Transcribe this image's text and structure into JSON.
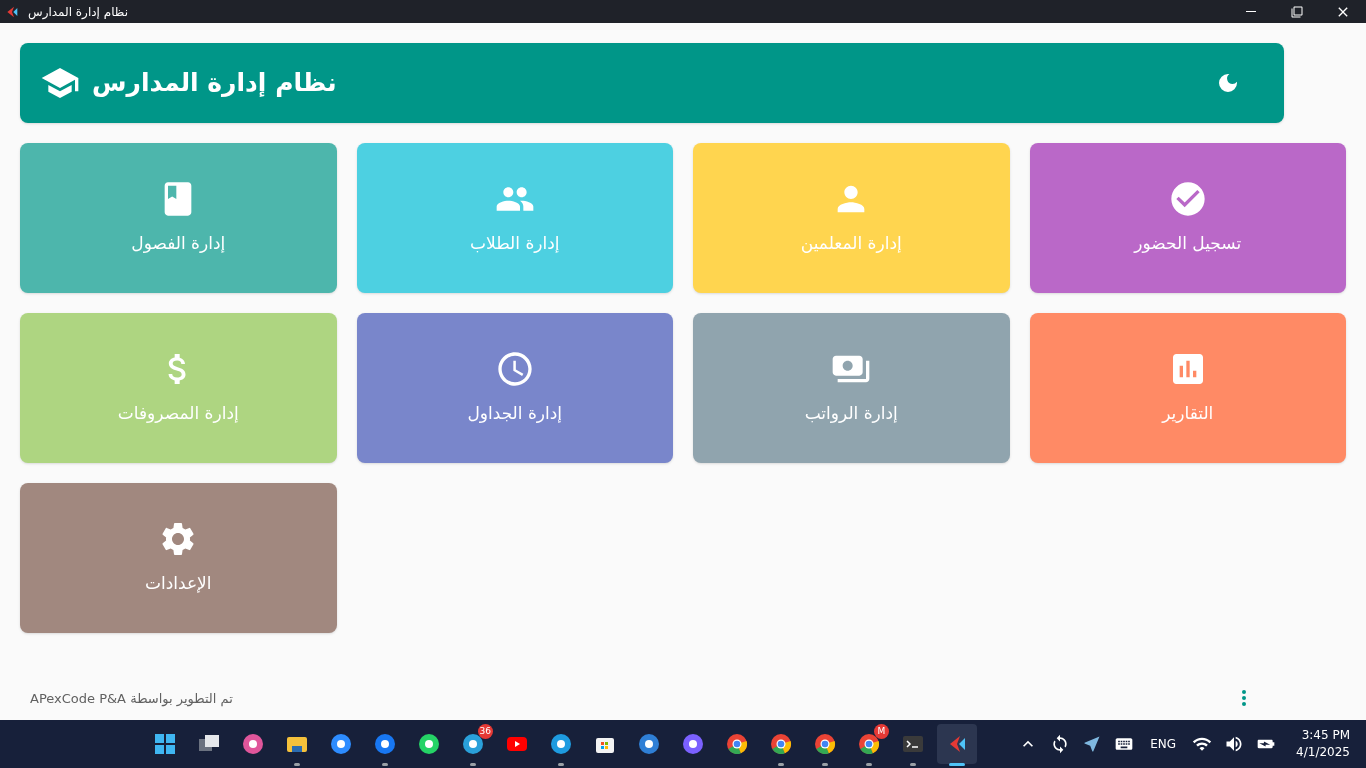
{
  "window": {
    "title": "نظام إدارة المدارس"
  },
  "header": {
    "title": "نظام إدارة المدارس"
  },
  "tiles": [
    {
      "label": "تسجيل الحضور",
      "color": "#ba68c8"
    },
    {
      "label": "إدارة المعلمين",
      "color": "#ffd54f"
    },
    {
      "label": "إدارة الطلاب",
      "color": "#4dd0e1"
    },
    {
      "label": "إدارة الفصول",
      "color": "#4db6ac"
    },
    {
      "label": "التقارير",
      "color": "#ff8a65"
    },
    {
      "label": "إدارة الرواتب",
      "color": "#90a4ae"
    },
    {
      "label": "إدارة الجداول",
      "color": "#7986cb"
    },
    {
      "label": "إدارة المصروفات",
      "color": "#aed581"
    },
    {
      "label": "الإعدادات",
      "color": "#a1887f"
    }
  ],
  "footer": {
    "credit": "APexCode P&A تم التطوير بواسطة"
  },
  "taskbar": {
    "apps": [
      {
        "running": true,
        "selected": true
      },
      {
        "running": true,
        "selected": false
      },
      {
        "running": true,
        "selected": false,
        "badge": "M"
      },
      {
        "running": true,
        "selected": false
      },
      {
        "running": true,
        "selected": false
      },
      {
        "running": false,
        "selected": false
      },
      {
        "running": false,
        "selected": false
      },
      {
        "running": false,
        "selected": false
      },
      {
        "running": false,
        "selected": false
      },
      {
        "running": true,
        "selected": false
      },
      {
        "running": false,
        "selected": false
      },
      {
        "running": true,
        "selected": false,
        "badge": "36"
      },
      {
        "running": false,
        "selected": false
      },
      {
        "running": true,
        "selected": false
      },
      {
        "running": false,
        "selected": false
      },
      {
        "running": true,
        "selected": false
      },
      {
        "running": false,
        "selected": false
      },
      {
        "running": false,
        "selected": false
      },
      {
        "running": false,
        "selected": false
      }
    ],
    "language": "ENG",
    "time": "3:45 PM",
    "date": "4/1/2025"
  }
}
